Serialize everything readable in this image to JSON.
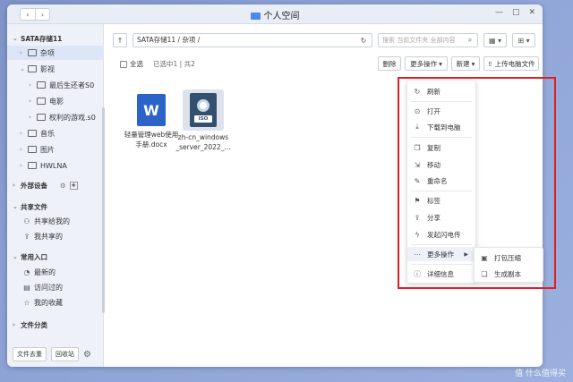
{
  "window": {
    "title": "个人空间"
  },
  "sidebar": {
    "root": "SATA存储11",
    "tree": [
      {
        "label": "杂项"
      },
      {
        "label": "影视"
      },
      {
        "label": "最后生还者S0"
      },
      {
        "label": "电影"
      },
      {
        "label": "权利的游戏.s0"
      },
      {
        "label": "音乐"
      },
      {
        "label": "图片"
      },
      {
        "label": "HWLNA"
      }
    ],
    "external": "外部设备",
    "shared_head": "共享文件",
    "shared_items": [
      "共享给我的",
      "我共享的"
    ],
    "common_head": "常用入口",
    "common_items": [
      "最新的",
      "访问过的",
      "我的收藏"
    ],
    "category": "文件分类",
    "bottom": {
      "move_label": "文件去重",
      "recycle_label": "回收站"
    }
  },
  "pathbar": {
    "path": "SATA存储11 / 杂项 /",
    "search_placeholder": "搜索 当前文件夹 全部内容"
  },
  "toolbar": {
    "select_all": "全选",
    "selected_info": "已选中1 | 共2",
    "delete": "删除",
    "more": "更多操作",
    "new": "新建",
    "upload": "上传电脑文件"
  },
  "files": [
    {
      "name": "轻量管理web使用手册.docx",
      "line1": "轻量管理web使用",
      "line2": "手册.docx",
      "icon_text": "W"
    },
    {
      "name": "zh-cn_windows_server_2022",
      "line1": "zh-cn_windows",
      "line2": "_server_2022_...",
      "icon_text": "ISO"
    }
  ],
  "context_menu": {
    "items": [
      {
        "label": "刷新",
        "icon": "refresh-icon"
      },
      {
        "label": "打开",
        "icon": "open-icon"
      },
      {
        "label": "下载到电脑",
        "icon": "download-icon"
      },
      {
        "label": "复制",
        "icon": "copy-icon"
      },
      {
        "label": "移动",
        "icon": "move-icon"
      },
      {
        "label": "重命名",
        "icon": "rename-icon"
      },
      {
        "label": "标签",
        "icon": "tag-icon"
      },
      {
        "label": "分享",
        "icon": "share-icon"
      },
      {
        "label": "发起闪电传",
        "icon": "lightning-icon"
      },
      {
        "label": "更多操作",
        "icon": "more-icon"
      },
      {
        "label": "详细信息",
        "icon": "info-icon"
      }
    ],
    "submenu": [
      {
        "label": "打包压缩",
        "icon": "archive-icon"
      },
      {
        "label": "生成副本",
        "icon": "duplicate-icon"
      }
    ]
  },
  "colors": {
    "highlight": "#e02020",
    "accent": "#2b63c9"
  },
  "watermark": "值 什么值得买"
}
